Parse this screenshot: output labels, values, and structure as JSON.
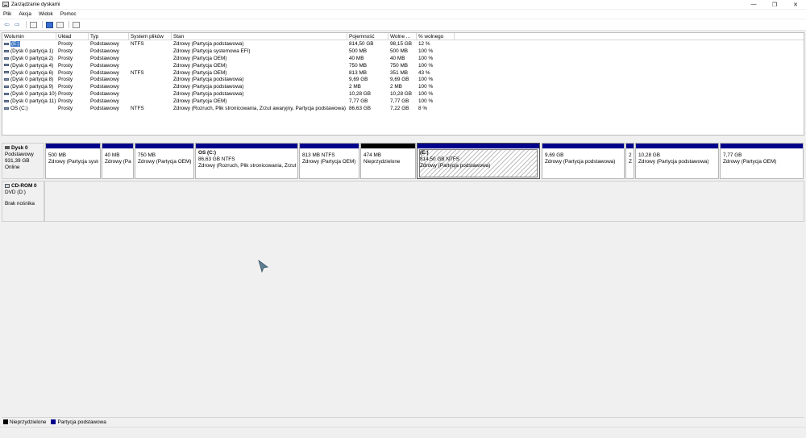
{
  "window": {
    "title": "Zarządzanie dyskami",
    "minimize": "—",
    "maximize": "❐",
    "close": "✕"
  },
  "menu": [
    "Plik",
    "Akcja",
    "Widok",
    "Pomoc"
  ],
  "toolbar": {
    "back": "⇦",
    "forward": "⇨"
  },
  "volume_table": {
    "headers": [
      "Wolumin",
      "Układ",
      "Typ",
      "System plików",
      "Stan",
      "Pojemność",
      "Wolne ...",
      "% wolnego"
    ],
    "rows": [
      [
        "(E:)",
        "Prosty",
        "Podstawowy",
        "NTFS",
        "Zdrowy (Partycja podstawowa)",
        "814,50 GB",
        "98,15 GB",
        "12 %"
      ],
      [
        "(Dysk 0 partycja 1)",
        "Prosty",
        "Podstawowy",
        "",
        "Zdrowy (Partycja systemowa EFI)",
        "500 MB",
        "500 MB",
        "100 %"
      ],
      [
        "(Dysk 0 partycja 2)",
        "Prosty",
        "Podstawowy",
        "",
        "Zdrowy (Partycja OEM)",
        "40 MB",
        "40 MB",
        "100 %"
      ],
      [
        "(Dysk 0 partycja 4)",
        "Prosty",
        "Podstawowy",
        "",
        "Zdrowy (Partycja OEM)",
        "750 MB",
        "750 MB",
        "100 %"
      ],
      [
        "(Dysk 0 partycja 6)",
        "Prosty",
        "Podstawowy",
        "NTFS",
        "Zdrowy (Partycja OEM)",
        "813 MB",
        "351 MB",
        "43 %"
      ],
      [
        "(Dysk 0 partycja 8)",
        "Prosty",
        "Podstawowy",
        "",
        "Zdrowy (Partycja podstawowa)",
        "9,69 GB",
        "9,69 GB",
        "100 %"
      ],
      [
        "(Dysk 0 partycja 9)",
        "Prosty",
        "Podstawowy",
        "",
        "Zdrowy (Partycja podstawowa)",
        "2 MB",
        "2 MB",
        "100 %"
      ],
      [
        "(Dysk 0 partycja 10)",
        "Prosty",
        "Podstawowy",
        "",
        "Zdrowy (Partycja podstawowa)",
        "10,28 GB",
        "10,28 GB",
        "100 %"
      ],
      [
        "(Dysk 0 partycja 11)",
        "Prosty",
        "Podstawowy",
        "",
        "Zdrowy (Partycja OEM)",
        "7,77 GB",
        "7,77 GB",
        "100 %"
      ],
      [
        "OS (C:)",
        "Prosty",
        "Podstawowy",
        "NTFS",
        "Zdrowy (Rozruch, Plik stronicowania, Zrzut awaryjny, Partycja podstawowa)",
        "86,63 GB",
        "7,22 GB",
        "8 %"
      ]
    ]
  },
  "disk0": {
    "name": "Dysk 0",
    "type": "Podstawowy",
    "size": "931,39 GB",
    "status": "Online",
    "partitions": [
      {
        "title": "",
        "line1": "500 MB",
        "line2": "Zdrowy (Partycja syste"
      },
      {
        "title": "",
        "line1": "40 MB",
        "line2": "Zdrowy (Par"
      },
      {
        "title": "",
        "line1": "750 MB",
        "line2": "Zdrowy (Partycja OEM)"
      },
      {
        "title": "OS  (C:)",
        "line1": "86,63 GB NTFS",
        "line2": "Zdrowy (Rozruch, Plik stronicowania, Zrzut a"
      },
      {
        "title": "",
        "line1": "813 MB NTFS",
        "line2": "Zdrowy (Partycja OEM)"
      },
      {
        "title": "",
        "line1": "474 MB",
        "line2": "Nieprzydzielone"
      },
      {
        "title": "(E:)",
        "line1": "814,50 GB NTFS",
        "line2": "Zdrowy (Partycja podstawowa)"
      },
      {
        "title": "",
        "line1": "9,69 GB",
        "line2": "Zdrowy (Partycja podstawowa)"
      },
      {
        "title": "",
        "line1": "2",
        "line2": "Z"
      },
      {
        "title": "",
        "line1": "10,28 GB",
        "line2": "Zdrowy (Partycja podstawowa)"
      },
      {
        "title": "",
        "line1": "7,77 GB",
        "line2": "Zdrowy (Partycja OEM)"
      }
    ]
  },
  "cdrom0": {
    "name": "CD-ROM 0",
    "type": "DVD (D:)",
    "status": "Brak nośnika"
  },
  "legend": [
    {
      "label": "Nieprzydzielone",
      "color": "#000000"
    },
    {
      "label": "Partycja podstawowa",
      "color": "#00008b"
    }
  ]
}
